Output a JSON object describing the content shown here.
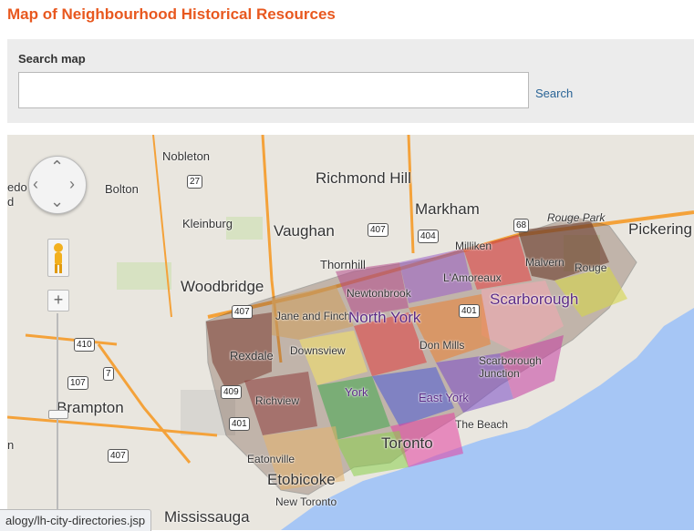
{
  "page_title": "Map of Neighbourhood Historical Resources",
  "search": {
    "label": "Search map",
    "value": "",
    "placeholder": "",
    "button": "Search"
  },
  "map": {
    "city_labels": {
      "nobleton": "Nobleton",
      "bolton": "Bolton",
      "kleinburg": "Kleinburg",
      "richmond_hill": "Richmond Hill",
      "vaughan": "Vaughan",
      "markham": "Markham",
      "rouge_park": "Rouge Park",
      "pickering": "Pickering",
      "milliken": "Milliken",
      "malvern": "Malvern",
      "rouge": "Rouge",
      "thornhill": "Thornhill",
      "woodbridge": "Woodbridge",
      "newtonbrook": "Newtonbrook",
      "lamoreaux": "L'Amoreaux",
      "scarborough": "Scarborough",
      "jane_and_finch": "Jane and Finch",
      "north_york": "North York",
      "rexdale": "Rexdale",
      "downsview": "Downsview",
      "don_mills": "Don Mills",
      "scarborough_junction": "Scarborough Junction",
      "york": "York",
      "east_york": "East York",
      "richview": "Richview",
      "brampton": "Brampton",
      "the_beach": "The Beach",
      "toronto": "Toronto",
      "eatonville": "Eatonville",
      "etobicoke": "Etobicoke",
      "new_toronto": "New Toronto",
      "mississauga": "Mississauga",
      "edge_left": "edo",
      "edge_left2": "d",
      "edge_left3": "n"
    },
    "highways": [
      "27",
      "407",
      "404",
      "68",
      "407",
      "401",
      "410",
      "107",
      "7",
      "409",
      "401",
      "407"
    ],
    "controls": {
      "zoom_in": "+",
      "zoom_out": "−"
    }
  },
  "status_bar": {
    "url": "alogy/lh-city-directories.jsp"
  },
  "colors": {
    "title": "#e8581f",
    "link": "#2a6496",
    "water": "#a6c6f5"
  }
}
